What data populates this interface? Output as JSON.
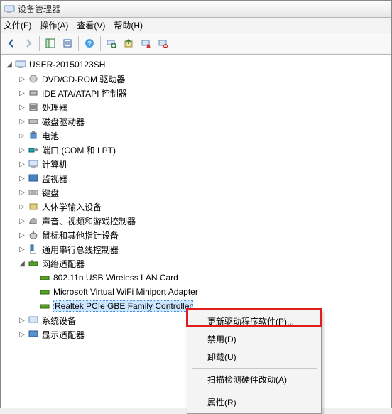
{
  "window": {
    "title": "设备管理器"
  },
  "menu": {
    "file": "文件(F)",
    "action": "操作(A)",
    "view": "查看(V)",
    "help": "帮助(H)"
  },
  "tree": {
    "root": "USER-20150123SH",
    "items": [
      "DVD/CD-ROM 驱动器",
      "IDE ATA/ATAPI 控制器",
      "处理器",
      "磁盘驱动器",
      "电池",
      "端口 (COM 和 LPT)",
      "计算机",
      "监视器",
      "键盘",
      "人体学输入设备",
      "声音、视频和游戏控制器",
      "鼠标和其他指针设备",
      "通用串行总线控制器",
      "网络适配器",
      "系统设备",
      "显示适配器"
    ],
    "network_children": [
      "802.11n USB Wireless LAN Card",
      "Microsoft Virtual WiFi Miniport Adapter",
      "Realtek PCIe GBE Family Controller"
    ]
  },
  "context_menu": {
    "update": "更新驱动程序软件(P)...",
    "disable": "禁用(D)",
    "uninstall": "卸载(U)",
    "scan": "扫描检测硬件改动(A)",
    "properties": "属性(R)"
  }
}
